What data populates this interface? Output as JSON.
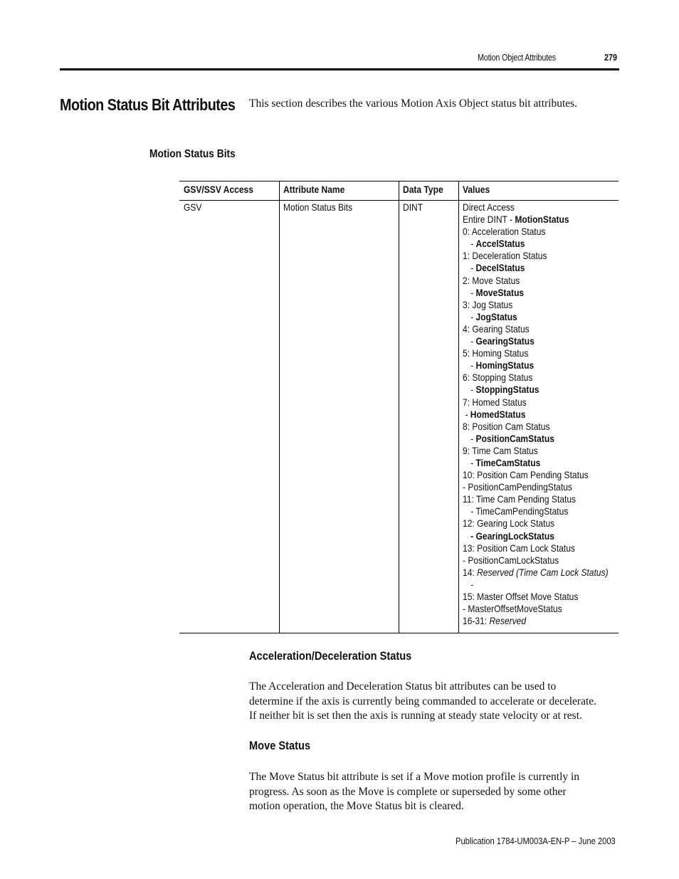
{
  "running_header": {
    "title": "Motion Object Attributes",
    "page_number": "279"
  },
  "section": {
    "title": "Motion Status Bit Attributes",
    "intro": "This section describes the various Motion Axis Object status bit attributes."
  },
  "subsection_title": "Motion Status Bits",
  "table": {
    "headers": [
      "GSV/SSV Access",
      "Attribute Name",
      "Data Type",
      "Values"
    ],
    "row": {
      "access": "GSV",
      "attribute_name": "Motion Status Bits",
      "data_type": "DINT",
      "values": [
        {
          "text": "Direct Access"
        },
        {
          "prefix": "Entire DINT - ",
          "bold": "MotionStatus"
        },
        {
          "text": "0: Acceleration Status"
        },
        {
          "prefix": "- ",
          "bold": "AccelStatus",
          "indent": "ind"
        },
        {
          "text": "1: Deceleration Status"
        },
        {
          "prefix": "- ",
          "bold": "DecelStatus",
          "indent": "ind"
        },
        {
          "text": "2: Move Status"
        },
        {
          "prefix": "- ",
          "bold": "MoveStatus",
          "indent": "ind"
        },
        {
          "text": "3: Jog Status"
        },
        {
          "prefix": "- ",
          "bold": "JogStatus",
          "indent": "ind"
        },
        {
          "text": "4: Gearing Status"
        },
        {
          "prefix": "- ",
          "bold": "GearingStatus",
          "indent": "ind"
        },
        {
          "text": "5: Homing Status"
        },
        {
          "prefix": "- ",
          "bold": "HomingStatus",
          "indent": "ind"
        },
        {
          "text": "6: Stopping Status"
        },
        {
          "prefix": "- ",
          "bold": "StoppingStatus",
          "indent": "ind"
        },
        {
          "text": "7: Homed Status"
        },
        {
          "prefix": "- ",
          "bold": "HomedStatus",
          "indent": "ind-s"
        },
        {
          "text": "8: Position Cam Status"
        },
        {
          "prefix": "- ",
          "bold": "PositionCamStatus",
          "indent": "ind"
        },
        {
          "text": "9: Time Cam Status"
        },
        {
          "prefix": "- ",
          "bold": "TimeCamStatus",
          "indent": "ind"
        },
        {
          "text": "10: Position Cam Pending Status"
        },
        {
          "text": "- PositionCamPendingStatus"
        },
        {
          "text": "11: Time Cam Pending Status"
        },
        {
          "text": "- TimeCamPendingStatus",
          "indent": "ind"
        },
        {
          "text": "12: Gearing Lock Status"
        },
        {
          "bold": "- GearingLockStatus",
          "indent": "ind"
        },
        {
          "text": "13: Position Cam Lock Status"
        },
        {
          "text": "- PositionCamLockStatus"
        },
        {
          "prefix": "14: ",
          "italic": "Reserved (Time Cam Lock Status)"
        },
        {
          "text": "-",
          "indent": "ind"
        },
        {
          "text": "15: Master Offset Move Status"
        },
        {
          "text": "- MasterOffsetMoveStatus"
        },
        {
          "prefix": "16-31: ",
          "italic": "Reserved"
        }
      ]
    }
  },
  "accel_decel": {
    "title": "Acceleration/Deceleration Status",
    "lines": [
      "The Acceleration and Deceleration Status bit attributes can be used to",
      "determine if the axis is currently being commanded to accelerate or decelerate.",
      "If neither bit is set then the axis is running at steady state velocity or at rest."
    ]
  },
  "move_status": {
    "title": "Move Status",
    "lines": [
      "The Move Status bit attribute is set if a Move motion profile is currently in",
      "progress. As soon as the Move is complete or superseded by some other",
      "motion operation, the Move Status bit is cleared."
    ]
  },
  "footer": {
    "publication": "Publication 1784-UM003A-EN-P – June 2003"
  }
}
